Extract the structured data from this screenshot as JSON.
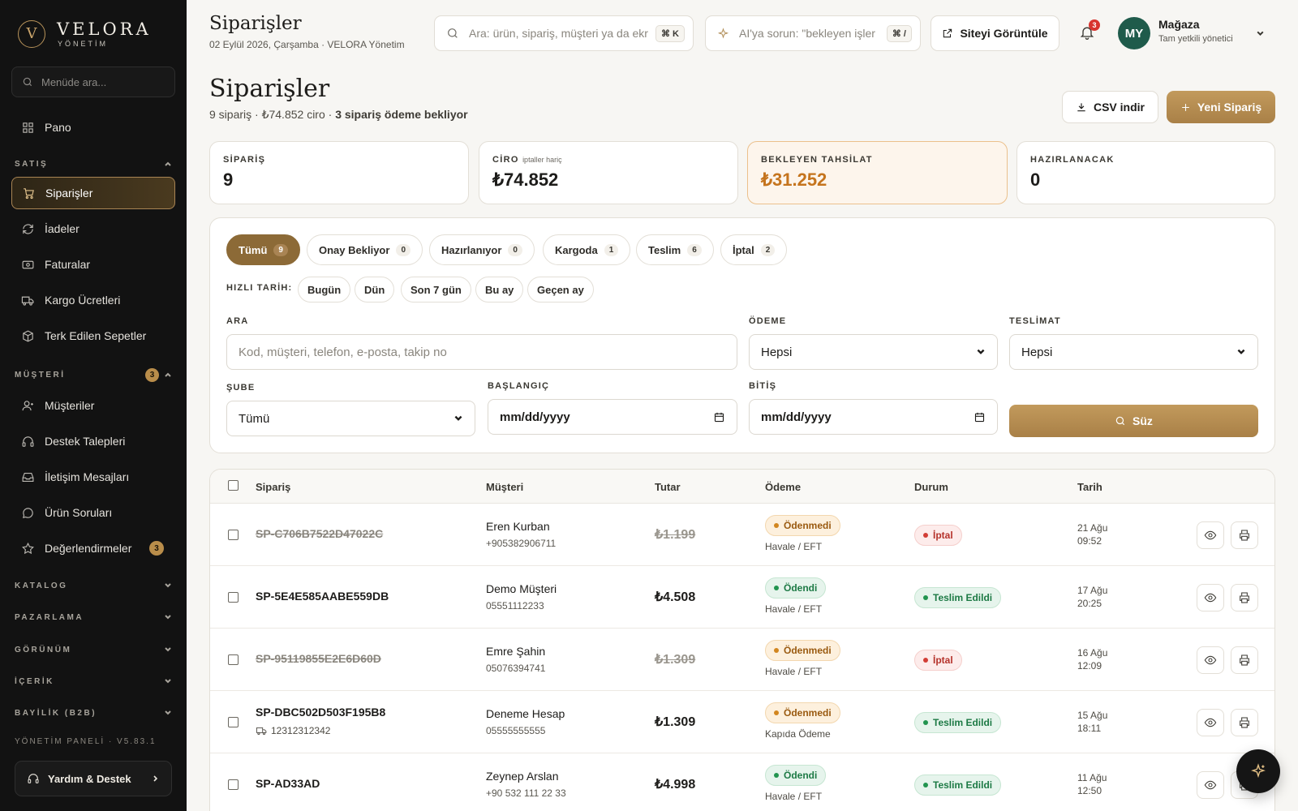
{
  "brand": {
    "name": "VELORA",
    "sub": "YÖNETİM",
    "mark": "V"
  },
  "sidebar": {
    "search_placeholder": "Menüde ara...",
    "home": "Pano",
    "group_sales": "SATIŞ",
    "sales_items": [
      "Siparişler",
      "İadeler",
      "Faturalar",
      "Kargo Ücretleri",
      "Terk Edilen Sepetler"
    ],
    "group_customer": "MÜŞTERİ",
    "group_customer_badge": "3",
    "customer_items": [
      "Müşteriler",
      "Destek Talepleri",
      "İletişim Mesajları",
      "Ürün Soruları",
      "Değerlendirmeler"
    ],
    "reviews_badge": "3",
    "groups_collapsed": [
      "KATALOG",
      "PAZARLAMA",
      "GÖRÜNÜM",
      "İÇERİK",
      "BAYİLİK (B2B)"
    ],
    "footer": "YÖNETİM PANELİ · V5.83.1",
    "help": "Yardım & Destek"
  },
  "topbar": {
    "title": "Siparişler",
    "subtitle": "02 Eylül 2026, Çarşamba · VELORA Yönetim",
    "search_placeholder": "Ara: ürün, sipariş, müşteri ya da ekr",
    "search_kbd": "⌘ K",
    "ai_placeholder": "AI'ya sorun: \"bekleyen işler",
    "ai_kbd": "⌘ /",
    "view_site": "Siteyi Görüntüle",
    "notif_count": "3",
    "avatar": "MY",
    "user_name": "Mağaza",
    "user_role": "Tam yetkili yönetici"
  },
  "page": {
    "title": "Siparişler",
    "sub_plain": "9 sipariş · ₺74.852 ciro · ",
    "sub_bold": "3 sipariş ödeme bekliyor",
    "csv": "CSV indir",
    "new_order": "Yeni Sipariş"
  },
  "stats": [
    {
      "label": "SİPARİŞ",
      "note": "",
      "value": "9"
    },
    {
      "label": "CİRO",
      "note": "iptaller hariç",
      "value": "₺74.852"
    },
    {
      "label": "BEKLEYEN TAHSİLAT",
      "note": "",
      "value": "₺31.252"
    },
    {
      "label": "HAZIRLANACAK",
      "note": "",
      "value": "0"
    }
  ],
  "tabs": [
    {
      "label": "Tümü",
      "count": "9"
    },
    {
      "label": "Onay Bekliyor",
      "count": "0"
    },
    {
      "label": "Hazırlanıyor",
      "count": "0"
    },
    {
      "label": "Kargoda",
      "count": "1"
    },
    {
      "label": "Teslim",
      "count": "6"
    },
    {
      "label": "İptal",
      "count": "2"
    }
  ],
  "quick_date": {
    "label": "HIZLI TARİH:",
    "chips": [
      "Bugün",
      "Dün",
      "Son 7 gün",
      "Bu ay",
      "Geçen ay"
    ]
  },
  "filters": {
    "search_label": "ARA",
    "search_placeholder": "Kod, müşteri, telefon, e-posta, takip no",
    "payment_label": "ÖDEME",
    "payment_value": "Hepsi",
    "delivery_label": "TESLİMAT",
    "delivery_value": "Hepsi",
    "branch_label": "ŞUBE",
    "branch_value": "Tümü",
    "start_label": "BAŞLANGIÇ",
    "start_value": "mm/dd/yyyy",
    "end_label": "BİTİŞ",
    "end_value": "mm/dd/yyyy",
    "submit": "Süz"
  },
  "table": {
    "headers": [
      "Sipariş",
      "Müşteri",
      "Tutar",
      "Ödeme",
      "Durum",
      "Tarih"
    ],
    "rows": [
      {
        "code": "SP-C706B7522D47022C",
        "tracking": "",
        "customer": "Eren Kurban",
        "phone": "+905382906711",
        "amount": "₺1.199",
        "payment": "Ödenmedi",
        "method": "Havale / EFT",
        "status": "İptal",
        "date": "21 Ağu",
        "time": "09:52"
      },
      {
        "code": "SP-5E4E585AABE559DB",
        "tracking": "",
        "customer": "Demo Müşteri",
        "phone": "05551112233",
        "amount": "₺4.508",
        "payment": "Ödendi",
        "method": "Havale / EFT",
        "status": "Teslim Edildi",
        "date": "17 Ağu",
        "time": "20:25"
      },
      {
        "code": "SP-95119855E2E6D60D",
        "tracking": "",
        "customer": "Emre Şahin",
        "phone": "05076394741",
        "amount": "₺1.309",
        "payment": "Ödenmedi",
        "method": "Havale / EFT",
        "status": "İptal",
        "date": "16 Ağu",
        "time": "12:09"
      },
      {
        "code": "SP-DBC502D503F195B8",
        "tracking": "12312312342",
        "customer": "Deneme Hesap",
        "phone": "05555555555",
        "amount": "₺1.309",
        "payment": "Ödenmedi",
        "method": "Kapıda Ödeme",
        "status": "Teslim Edildi",
        "date": "15 Ağu",
        "time": "18:11"
      },
      {
        "code": "SP-AD33AD",
        "tracking": "",
        "customer": "Zeynep Arslan",
        "phone": "+90 532 111 22 33",
        "amount": "₺4.998",
        "payment": "Ödendi",
        "method": "Havale / EFT",
        "status": "Teslim Edildi",
        "date": "11 Ağu",
        "time": "12:50"
      }
    ]
  },
  "icons": {
    "search": "search-icon",
    "ai": "sparkle-icon",
    "external": "external-link-icon",
    "bell": "bell-icon",
    "download": "download-icon",
    "plus": "plus-icon",
    "eye": "eye-icon",
    "print": "printer-icon",
    "truck": "truck-icon"
  },
  "colors": {
    "accent": "#a98047",
    "sidebar_bg": "#121212",
    "paid": "#22944f",
    "unpaid": "#d2861f",
    "cancel": "#d23d35"
  }
}
